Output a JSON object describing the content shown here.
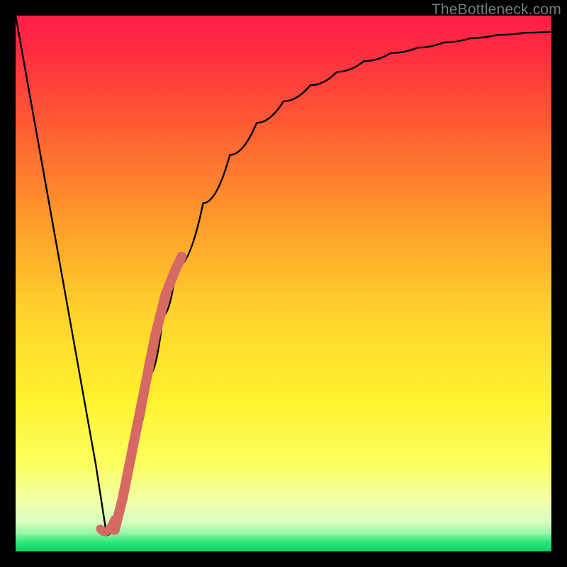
{
  "watermark": "TheBottleneck.com",
  "colors": {
    "frame": "#000000",
    "gradient_top": "#ff1f47",
    "gradient_mid1": "#ff6a2b",
    "gradient_mid2": "#ffc229",
    "gradient_mid3": "#fff35a",
    "gradient_pale": "#f6ffb5",
    "gradient_green": "#16e26b",
    "curve": "#000000",
    "marker": "#d46a63"
  },
  "chart_data": {
    "type": "line",
    "title": "",
    "xlabel": "",
    "ylabel": "",
    "xlim": [
      0,
      100
    ],
    "ylim": [
      0,
      100
    ],
    "series": [
      {
        "name": "bottleneck-curve",
        "x": [
          0,
          2.5,
          5,
          7.5,
          10,
          12.5,
          15,
          17,
          20,
          22.5,
          25,
          27.5,
          30,
          35,
          40,
          45,
          50,
          55,
          60,
          65,
          70,
          75,
          80,
          85,
          90,
          95,
          100
        ],
        "y": [
          100,
          86,
          72,
          58,
          44,
          30,
          16,
          3,
          10,
          22,
          33,
          44,
          53,
          65,
          74,
          80,
          84,
          87,
          89.5,
          91.5,
          93,
          94,
          95,
          95.8,
          96.4,
          96.8,
          97
        ]
      }
    ],
    "highlight_segment": {
      "name": "marker-band",
      "x": [
        18.5,
        20,
        22,
        24,
        26,
        28,
        30,
        31
      ],
      "y": [
        4,
        10,
        20,
        30,
        40,
        48,
        53,
        55
      ]
    },
    "green_band_y": [
      0,
      3
    ],
    "minimum": {
      "x": 17,
      "y": 3
    }
  }
}
